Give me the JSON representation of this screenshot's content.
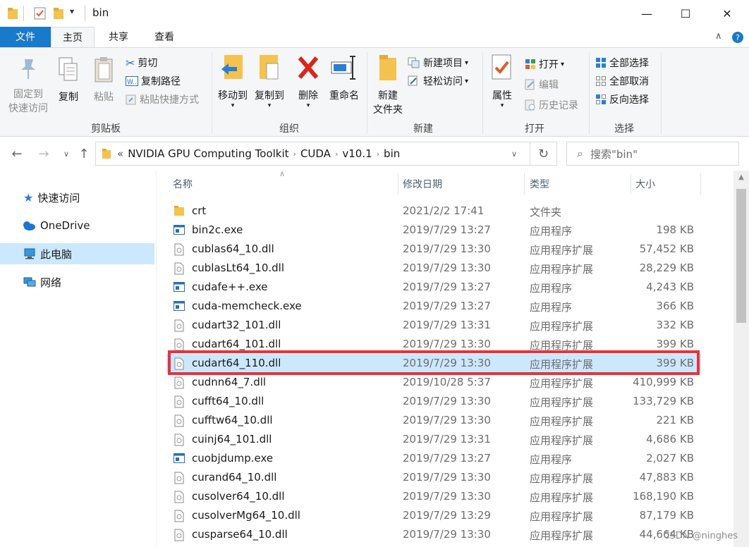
{
  "window": {
    "title": "bin",
    "minimize": "—",
    "maximize": "☐",
    "close": "✕"
  },
  "tabs": {
    "file": "文件",
    "home": "主页",
    "share": "共享",
    "view": "查看"
  },
  "ribbon": {
    "pin_line1": "固定到",
    "pin_line2": "快速访问",
    "copy": "复制",
    "paste": "粘贴",
    "cut": "剪切",
    "copy_path": "复制路径",
    "paste_shortcut": "粘贴快捷方式",
    "clipboard_group": "剪贴板",
    "move_to": "移动到",
    "copy_to": "复制到",
    "delete": "删除",
    "rename": "重命名",
    "organize_group": "组织",
    "new_folder_line1": "新建",
    "new_folder_line2": "文件夹",
    "new_item": "新建项目",
    "easy_access": "轻松访问",
    "new_group": "新建",
    "properties": "属性",
    "open": "打开",
    "edit": "编辑",
    "history": "历史记录",
    "open_group": "打开",
    "select_all": "全部选择",
    "select_none": "全部取消",
    "invert_selection": "反向选择",
    "select_group": "选择"
  },
  "address": {
    "prefix": "«",
    "crumbs": [
      "NVIDIA GPU Computing Toolkit",
      "CUDA",
      "v10.1",
      "bin"
    ],
    "search_placeholder": "搜索\"bin\""
  },
  "navpane": {
    "items": [
      {
        "label": "快速访问",
        "icon": "star-icon"
      },
      {
        "label": "OneDrive",
        "icon": "cloud-icon"
      },
      {
        "label": "此电脑",
        "icon": "computer-icon"
      },
      {
        "label": "网络",
        "icon": "network-icon"
      }
    ]
  },
  "columns": {
    "name": "名称",
    "date": "修改日期",
    "type": "类型",
    "size": "大小"
  },
  "files": [
    {
      "name": "crt",
      "date": "2021/2/2 17:41",
      "type": "文件夹",
      "size": "",
      "kind": "folder"
    },
    {
      "name": "bin2c.exe",
      "date": "2019/7/29 13:27",
      "type": "应用程序",
      "size": "198 KB",
      "kind": "exe"
    },
    {
      "name": "cublas64_10.dll",
      "date": "2019/7/29 13:30",
      "type": "应用程序扩展",
      "size": "57,452 KB",
      "kind": "dll"
    },
    {
      "name": "cublasLt64_10.dll",
      "date": "2019/7/29 13:30",
      "type": "应用程序扩展",
      "size": "28,229 KB",
      "kind": "dll"
    },
    {
      "name": "cudafe++.exe",
      "date": "2019/7/29 13:27",
      "type": "应用程序",
      "size": "4,243 KB",
      "kind": "exe"
    },
    {
      "name": "cuda-memcheck.exe",
      "date": "2019/7/29 13:27",
      "type": "应用程序",
      "size": "366 KB",
      "kind": "exe"
    },
    {
      "name": "cudart32_101.dll",
      "date": "2019/7/29 13:31",
      "type": "应用程序扩展",
      "size": "332 KB",
      "kind": "dll"
    },
    {
      "name": "cudart64_101.dll",
      "date": "2019/7/29 13:30",
      "type": "应用程序扩展",
      "size": "399 KB",
      "kind": "dll"
    },
    {
      "name": "cudart64_110.dll",
      "date": "2019/7/29 13:30",
      "type": "应用程序扩展",
      "size": "399 KB",
      "kind": "dll",
      "selected": true
    },
    {
      "name": "cudnn64_7.dll",
      "date": "2019/10/28 5:37",
      "type": "应用程序扩展",
      "size": "410,999 KB",
      "kind": "dll"
    },
    {
      "name": "cufft64_10.dll",
      "date": "2019/7/29 13:30",
      "type": "应用程序扩展",
      "size": "133,729 KB",
      "kind": "dll"
    },
    {
      "name": "cufftw64_10.dll",
      "date": "2019/7/29 13:30",
      "type": "应用程序扩展",
      "size": "221 KB",
      "kind": "dll"
    },
    {
      "name": "cuinj64_101.dll",
      "date": "2019/7/29 13:31",
      "type": "应用程序扩展",
      "size": "4,686 KB",
      "kind": "dll"
    },
    {
      "name": "cuobjdump.exe",
      "date": "2019/7/29 13:27",
      "type": "应用程序",
      "size": "2,027 KB",
      "kind": "exe"
    },
    {
      "name": "curand64_10.dll",
      "date": "2019/7/29 13:30",
      "type": "应用程序扩展",
      "size": "47,883 KB",
      "kind": "dll"
    },
    {
      "name": "cusolver64_10.dll",
      "date": "2019/7/29 13:30",
      "type": "应用程序扩展",
      "size": "168,190 KB",
      "kind": "dll"
    },
    {
      "name": "cusolverMg64_10.dll",
      "date": "2019/7/29 13:29",
      "type": "应用程序扩展",
      "size": "87,179 KB",
      "kind": "dll"
    },
    {
      "name": "cusparse64_10.dll",
      "date": "2019/7/29 13:30",
      "type": "应用程序扩展",
      "size": "44,664 KB",
      "kind": "dll"
    }
  ],
  "watermark": "CSDN @ninghes",
  "colors": {
    "accent": "#1979ca",
    "selection": "#cce8ff",
    "highlight_box": "#e8323c",
    "folder": "#f4c24e"
  }
}
